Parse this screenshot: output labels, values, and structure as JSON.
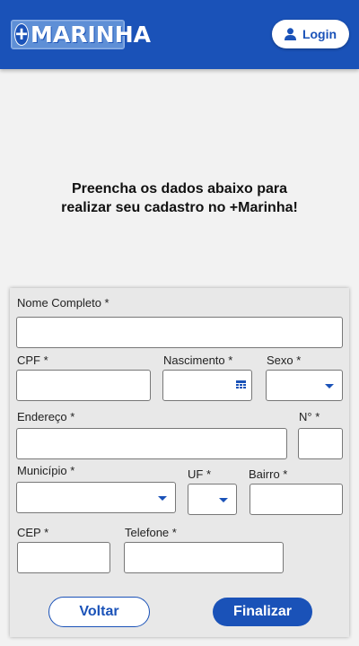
{
  "header": {
    "logo_plus": "+",
    "logo_text": "MARINHA",
    "login_label": "Login"
  },
  "intro": {
    "line1": "Preencha os dados abaixo para",
    "line2": "realizar seu cadastro no +Marinha!"
  },
  "form": {
    "nome_label": "Nome Completo *",
    "cpf_label": "CPF *",
    "nascimento_label": "Nascimento *",
    "sexo_label": "Sexo *",
    "endereco_label": "Endereço *",
    "numero_label": "N° *",
    "municipio_label": "Município *",
    "uf_label": "UF *",
    "bairro_label": "Bairro *",
    "cep_label": "CEP *",
    "telefone_label": "Telefone *"
  },
  "actions": {
    "voltar_label": "Voltar",
    "finalizar_label": "Finalizar"
  },
  "colors": {
    "primary": "#1a52b8",
    "background": "#f2f2f2",
    "card": "#e8e8e8"
  },
  "icons": {
    "login": "user-icon",
    "date": "calendar-icon",
    "select": "chevron-down-icon"
  }
}
